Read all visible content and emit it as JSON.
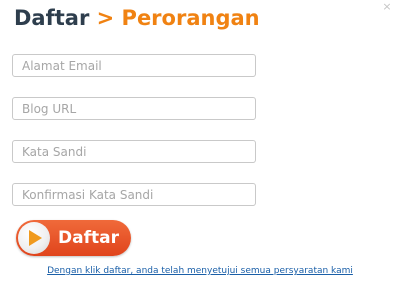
{
  "header": {
    "title_main": "Daftar",
    "title_separator": ">",
    "title_sub": "Perorangan",
    "close_glyph": "×",
    "close_icon": "close-icon"
  },
  "form": {
    "email": {
      "placeholder": "Alamat Email",
      "value": ""
    },
    "blog_url": {
      "placeholder": "Blog URL",
      "value": ""
    },
    "password": {
      "placeholder": "Kata Sandi",
      "value": ""
    },
    "confirm_password": {
      "placeholder": "Konfirmasi Kata Sandi",
      "value": ""
    }
  },
  "submit": {
    "label": "Daftar",
    "icon": "play-icon"
  },
  "terms": {
    "text": "Dengan klik daftar, anda telah menyetujui semua persyaratan kami"
  },
  "colors": {
    "title_dark": "#2e3e4d",
    "accent_orange": "#f08212",
    "button_red": "#e8532a",
    "link_blue": "#1a5fa8"
  }
}
